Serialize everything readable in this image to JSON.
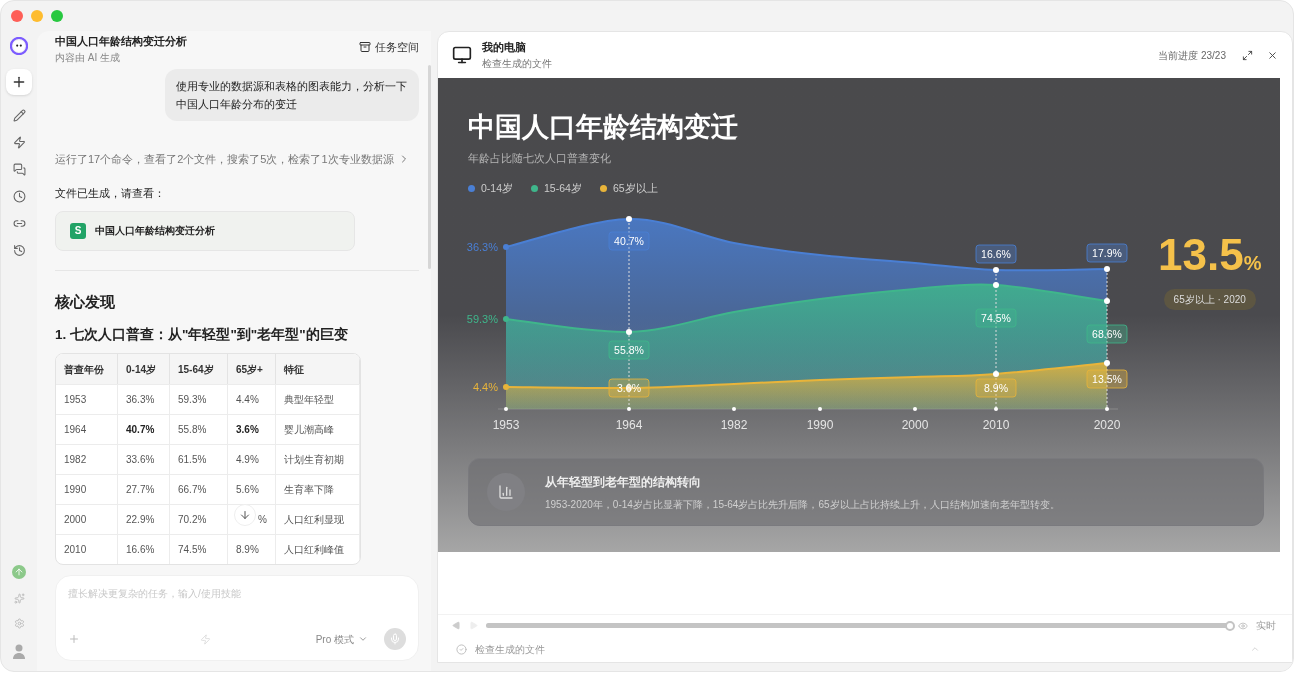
{
  "chat": {
    "title": "中国人口年龄结构变迁分析",
    "subtitle": "内容由 AI 生成",
    "workspace_button": "任务空间",
    "user_message": "使用专业的数据源和表格的图表能力，分析一下中国人口年龄分布的变迁",
    "activity_summary": "运行了17个命令，查看了2个文件，搜索了5次，检索了1次专业数据源",
    "files_intro": "文件已生成，请查看：",
    "file": {
      "badge": "S",
      "name": "中国人口年龄结构变迁分析"
    },
    "heading": "核心发现",
    "subheading": "1. 七次人口普查：从\"年轻型\"到\"老年型\"的巨变",
    "table": {
      "columns": [
        "普查年份",
        "0-14岁",
        "15-64岁",
        "65岁+",
        "特征"
      ],
      "rows": [
        {
          "cells": [
            {
              "text": "1953",
              "bold": false
            },
            {
              "text": "36.3%",
              "bold": false
            },
            {
              "text": "59.3%",
              "bold": false
            },
            {
              "text": "4.4%",
              "bold": false
            },
            {
              "text": "典型年轻型",
              "bold": false
            }
          ]
        },
        {
          "cells": [
            {
              "text": "1964",
              "bold": false
            },
            {
              "text": "40.7%",
              "bold": true
            },
            {
              "text": "55.8%",
              "bold": false
            },
            {
              "text": "3.6%",
              "bold": true
            },
            {
              "text": "婴儿潮高峰",
              "bold": false
            }
          ]
        },
        {
          "cells": [
            {
              "text": "1982",
              "bold": false
            },
            {
              "text": "33.6%",
              "bold": false
            },
            {
              "text": "61.5%",
              "bold": false
            },
            {
              "text": "4.9%",
              "bold": false
            },
            {
              "text": "计划生育初期",
              "bold": false
            }
          ]
        },
        {
          "cells": [
            {
              "text": "1990",
              "bold": false
            },
            {
              "text": "27.7%",
              "bold": false
            },
            {
              "text": "66.7%",
              "bold": false
            },
            {
              "text": "5.6%",
              "bold": false
            },
            {
              "text": "生育率下降",
              "bold": false
            }
          ]
        },
        {
          "cells": [
            {
              "text": "2000",
              "bold": false
            },
            {
              "text": "22.9%",
              "bold": false
            },
            {
              "text": "70.2%",
              "bold": false
            },
            {
              "text": "%",
              "bold": false
            },
            {
              "text": "人口红利显现",
              "bold": false
            }
          ]
        },
        {
          "cells": [
            {
              "text": "2010",
              "bold": false
            },
            {
              "text": "16.6%",
              "bold": false
            },
            {
              "text": "74.5%",
              "bold": false
            },
            {
              "text": "8.9%",
              "bold": false
            },
            {
              "text": "人口红利峰值",
              "bold": false
            }
          ]
        }
      ]
    },
    "composer": {
      "placeholder": "擅长解决更复杂的任务，输入/使用技能",
      "mode": "Pro 模式"
    }
  },
  "preview": {
    "title": "我的电脑",
    "subtitle": "检查生成的文件",
    "progress": "当前进度 23/23",
    "slide": {
      "title": "中国人口年龄结构变迁",
      "subtitle": "年龄占比随七次人口普查变化",
      "chart": {
        "x_labels": [
          "1953",
          "1964",
          "1982",
          "1990",
          "2000",
          "2010",
          "2020"
        ],
        "series": [
          {
            "name": "0-14岁",
            "color": "#4a7fd4",
            "labels": [
              "36.3%",
              "40.7%",
              "16.6%",
              "17.9%"
            ]
          },
          {
            "name": "15-64岁",
            "color": "#3fb68b",
            "labels": [
              "59.3%",
              "55.8%",
              "74.5%",
              "68.6%"
            ]
          },
          {
            "name": "65岁以上",
            "color": "#e8b43a",
            "labels": [
              "4.4%",
              "3.6%",
              "8.9%",
              "13.5%"
            ]
          }
        ]
      },
      "highlight": {
        "value": "13.5",
        "unit": "%",
        "caption": "65岁以上 · 2020"
      },
      "insight": {
        "title": "从年轻型到老年型的结构转向",
        "text": "1953-2020年，0-14岁占比显著下降，15-64岁占比先升后降，65岁以上占比持续上升，人口结构加速向老年型转变。"
      }
    },
    "timeline": {
      "level": 1,
      "live_label": "实时"
    },
    "footer": "检查生成的文件"
  }
}
